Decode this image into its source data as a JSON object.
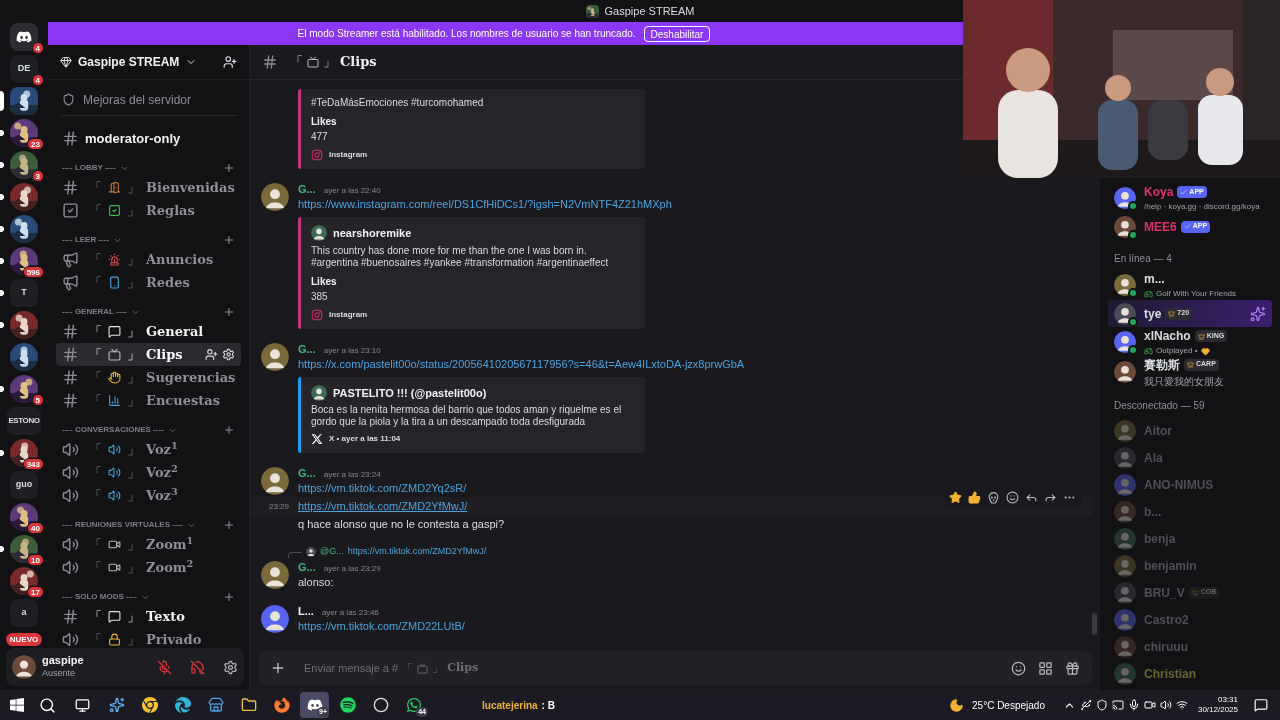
{
  "window": {
    "title": "Gaspipe STREAM"
  },
  "banner": {
    "text": "El modo Streamer está habilitado. Los nombres de usuario se han truncado.",
    "button": "Deshabilitar"
  },
  "servers": [
    {
      "kind": "logo",
      "badge": "4",
      "selected": false,
      "unread": false
    },
    {
      "kind": "text",
      "label": "DE",
      "badge": "4",
      "selected": false,
      "unread": false
    },
    {
      "kind": "picture",
      "selected": true,
      "unread": false
    },
    {
      "kind": "picture",
      "badge": "23",
      "selected": false,
      "unread": true
    },
    {
      "kind": "picture",
      "badge": "3",
      "selected": false,
      "unread": true
    },
    {
      "kind": "picture",
      "selected": false,
      "unread": true
    },
    {
      "kind": "picture",
      "selected": false,
      "unread": true
    },
    {
      "kind": "picture",
      "badge": "596",
      "selected": false,
      "unread": true
    },
    {
      "kind": "text",
      "label": "T",
      "selected": false,
      "unread": true
    },
    {
      "kind": "picture",
      "selected": false,
      "unread": true
    },
    {
      "kind": "picture",
      "selected": false,
      "unread": false
    },
    {
      "kind": "picture",
      "badge": "5",
      "selected": false,
      "unread": true
    },
    {
      "kind": "text",
      "label": "ESTONO",
      "selected": false,
      "unread": false
    },
    {
      "kind": "picture",
      "badge": "343",
      "selected": false,
      "unread": true
    },
    {
      "kind": "text",
      "label": "guo",
      "selected": false,
      "unread": false
    },
    {
      "kind": "picture",
      "badge": "40",
      "selected": false,
      "unread": false
    },
    {
      "kind": "picture",
      "badge": "10",
      "selected": false,
      "unread": true
    },
    {
      "kind": "picture",
      "badge": "17",
      "selected": false,
      "unread": false
    },
    {
      "kind": "text",
      "label": "a",
      "selected": false,
      "unread": false
    }
  ],
  "new_badge": "NUEVO",
  "server": {
    "name": "Gaspipe STREAM"
  },
  "sidebar_links": [
    {
      "label": "Mejoras del servidor"
    }
  ],
  "top_channels": [
    {
      "kind": "text",
      "name": "moderator-only",
      "unread": true,
      "selected": false
    }
  ],
  "categories": [
    {
      "name": "---- LOBBY ----",
      "channels": [
        {
          "kind": "text",
          "open": "「",
          "close": "」",
          "name": "Bienvenidas",
          "unread": false,
          "selected": false
        },
        {
          "kind": "rules",
          "open": "「",
          "close": "」",
          "name": "Reglas",
          "unread": false,
          "selected": false
        }
      ]
    },
    {
      "name": "---- LEER ----",
      "channels": [
        {
          "kind": "announce",
          "open": "「",
          "close": "」",
          "name": "Anuncios",
          "unread": false,
          "selected": false
        },
        {
          "kind": "announce",
          "open": "「",
          "close": "」",
          "name": "Redes",
          "unread": false,
          "selected": false
        }
      ]
    },
    {
      "name": "---- GENERAL ----",
      "channels": [
        {
          "kind": "text",
          "open": "「",
          "close": "」",
          "name": "General",
          "unread": true,
          "selected": false
        },
        {
          "kind": "text",
          "open": "「",
          "close": "」",
          "name": "Clips",
          "unread": false,
          "selected": true
        },
        {
          "kind": "text",
          "open": "「",
          "close": "」",
          "name": "Sugerencias",
          "unread": false,
          "selected": false
        },
        {
          "kind": "text",
          "open": "「",
          "close": "」",
          "name": "Encuestas",
          "unread": false,
          "selected": false
        }
      ]
    },
    {
      "name": "---- CONVERSACIONES ----",
      "channels": [
        {
          "kind": "voice",
          "open": "「",
          "close": "」",
          "name": "Voz$^{1}$",
          "unread": false,
          "selected": false
        },
        {
          "kind": "voice",
          "open": "「",
          "close": "」",
          "name": "Voz$^{2}$",
          "unread": false,
          "selected": false
        },
        {
          "kind": "voice",
          "open": "「",
          "close": "」",
          "name": "Voz$^{3}$",
          "unread": false,
          "selected": false
        }
      ]
    },
    {
      "name": "---- REUNIONES VIRTUALES ----",
      "channels": [
        {
          "kind": "stage",
          "open": "「",
          "close": "」",
          "name": "Zoom$^{1}$",
          "unread": false,
          "selected": false
        },
        {
          "kind": "stage",
          "open": "「",
          "close": "」",
          "name": "Zoom$^{2}$",
          "unread": false,
          "selected": false
        }
      ]
    },
    {
      "name": "---- SOLO MODS ----",
      "channels": [
        {
          "kind": "text",
          "open": "「",
          "close": "」",
          "name": "Texto",
          "unread": true,
          "selected": false
        },
        {
          "kind": "stage",
          "open": "「",
          "close": "」",
          "name": "Privado",
          "unread": false,
          "selected": false
        }
      ]
    }
  ],
  "user": {
    "name": "gaspipe",
    "status": "Ausente",
    "muted": true,
    "deafened": true
  },
  "chat_header": {
    "open": "「",
    "close": "」",
    "name": "Clips"
  },
  "messages": [
    {
      "kind": "continuation",
      "embed": {
        "kind": "instagram",
        "color": "#c13584",
        "lines": [
          "#TeDaMásEmociones #turcomohamed"
        ],
        "field_label": "Likes",
        "field_value": "477",
        "footer": "Instagram"
      }
    },
    {
      "kind": "group",
      "author": "G...",
      "color": "#43b581",
      "time": "ayer a las 22:40",
      "lines": [
        {
          "kind": "link",
          "text": "https://www.instagram.com/reel/DS1CfHiDCs1/?igsh=N2VmNTF4Z21hMXph",
          "hovered": false
        }
      ],
      "embed": {
        "kind": "instagram",
        "color": "#c13584",
        "author": "nearshoremike",
        "lines": [
          "This country has done more for me than the one I was born in. #argentina #buenosaires #yankee #transformation #argentinaeffect"
        ],
        "field_label": "Likes",
        "field_value": "385",
        "footer": "Instagram"
      }
    },
    {
      "kind": "group",
      "author": "G...",
      "color": "#43b581",
      "time": "ayer a las 23:10",
      "lines": [
        {
          "kind": "link",
          "text": "https://x.com/pastelit00o/status/2005641020567117956?s=46&t=Aew4ILxtoDA-jzx8prwGbA",
          "hovered": false
        }
      ],
      "embed": {
        "kind": "x",
        "color": "#1d9bf0",
        "author": "PASTELITO !!! (@pastelit00o)",
        "lines": [
          "Boca es la nenita hermosa del barrio que todos aman y riquelme es el gordo que la piola y la tira a un descampado toda desfigurada"
        ],
        "footer": "X • ayer a las 11:04"
      }
    },
    {
      "kind": "group",
      "author": "G...",
      "color": "#43b581",
      "time": "ayer a las 23:24",
      "lines": [
        {
          "kind": "link",
          "text": "https://vm.tiktok.com/ZMD2Yq2sR/",
          "hovered": false
        },
        {
          "kind": "link",
          "text": "https://vm.tiktok.com/ZMD2YfMwJ/",
          "hovered": true,
          "hover_time": "23:29"
        },
        {
          "kind": "text",
          "text": "q hace alonso que no le contesta a gaspi?",
          "hovered": false
        }
      ]
    },
    {
      "kind": "group",
      "author": "G...",
      "color": "#43b581",
      "time": "ayer a las 23:29",
      "reply": {
        "author": "@G...",
        "text": "https://vm.tiktok.com/ZMD2YfMwJ/"
      },
      "lines": [
        {
          "kind": "text",
          "text": "alonso:",
          "hovered": false
        }
      ]
    },
    {
      "kind": "group",
      "author": "L...",
      "color": "#f2f3f5",
      "time": "ayer a las 23:46",
      "lines": [
        {
          "kind": "link",
          "text": "https://vm.tiktok.com/ZMD22LUtB/",
          "hovered": false
        }
      ]
    }
  ],
  "composer": {
    "before": "Enviar mensaje a #",
    "open": "「",
    "close": "」",
    "channel": "Clips"
  },
  "members": [
    {
      "kind": "member",
      "name": "Koya",
      "color": "#e0306a",
      "tag": {
        "kind": "app",
        "text": "APP"
      },
      "sub": "/help · koya.gg · discord.gg/koya",
      "online": true,
      "highlight": false,
      "dim": false
    },
    {
      "kind": "member",
      "name": "MEE6",
      "color": "#e0306a",
      "tag": {
        "kind": "app",
        "text": "APP"
      },
      "online": true,
      "highlight": false,
      "dim": false
    },
    {
      "kind": "header",
      "text": "En línea — 4"
    },
    {
      "kind": "member",
      "name": "m...",
      "color": "#dbdee1",
      "sub": "Golf With Your Friends",
      "game": true,
      "online": true,
      "highlight": false,
      "dim": false
    },
    {
      "kind": "member",
      "name": "tye",
      "color": "#dbdee1",
      "tag": {
        "kind": "guild",
        "text": "720"
      },
      "online": true,
      "highlight": true,
      "dim": false
    },
    {
      "kind": "member",
      "name": "xlNacho",
      "color": "#dbdee1",
      "tag": {
        "kind": "guild",
        "text": "KING"
      },
      "sub": "Outplayed •",
      "game": true,
      "heart": true,
      "online": true,
      "highlight": false,
      "dim": false
    },
    {
      "kind": "member",
      "name": "賽勒斯",
      "color": "#dbdee1",
      "tag": {
        "kind": "guild",
        "text": "CARP"
      },
      "sub": "我只愛我的女朋友",
      "online": false,
      "highlight": false,
      "dim": false
    },
    {
      "kind": "header",
      "text": "Desconectado — 59"
    },
    {
      "kind": "member",
      "name": "Aitor",
      "color": "#4e5058",
      "online": false,
      "highlight": false,
      "dim": true
    },
    {
      "kind": "member",
      "name": "Ala",
      "color": "#4e5058",
      "online": false,
      "highlight": false,
      "dim": true
    },
    {
      "kind": "member",
      "name": "ANO-NIMUS",
      "color": "#4e5058",
      "online": false,
      "highlight": false,
      "dim": true
    },
    {
      "kind": "member",
      "name": "b...",
      "color": "#4e5058",
      "online": false,
      "highlight": false,
      "dim": true
    },
    {
      "kind": "member",
      "name": "benja",
      "color": "#4e5058",
      "online": false,
      "highlight": false,
      "dim": true
    },
    {
      "kind": "member",
      "name": "benjamin",
      "color": "#4e5058",
      "online": false,
      "highlight": false,
      "dim": true
    },
    {
      "kind": "member",
      "name": "BRU_V",
      "color": "#4e5058",
      "tag": {
        "kind": "guild",
        "text": "COB"
      },
      "online": false,
      "highlight": false,
      "dim": true
    },
    {
      "kind": "member",
      "name": "Castro2",
      "color": "#4e5058",
      "online": false,
      "highlight": false,
      "dim": true
    },
    {
      "kind": "member",
      "name": "chiruuu",
      "color": "#4e5058",
      "online": false,
      "highlight": false,
      "dim": true
    },
    {
      "kind": "member",
      "name": "Christian",
      "color": "#6b6433",
      "online": false,
      "highlight": false,
      "dim": true
    }
  ],
  "taskbar": {
    "apps": [
      {
        "kind": "copilot",
        "active": false
      },
      {
        "kind": "chrome",
        "active": false
      },
      {
        "kind": "edge",
        "active": false
      },
      {
        "kind": "store",
        "active": false
      },
      {
        "kind": "files",
        "active": false
      },
      {
        "kind": "firefox",
        "active": false
      },
      {
        "kind": "discord",
        "active": true,
        "badge": "9+"
      },
      {
        "kind": "spotify",
        "active": false
      },
      {
        "kind": "obs",
        "active": false
      },
      {
        "kind": "whatsapp",
        "active": false,
        "badge": "44"
      }
    ],
    "now_playing": {
      "user": "lucatejerina",
      "text": ": B"
    },
    "weather": "25°C Despejado",
    "time": "03:31",
    "date": "30/12/2025"
  }
}
